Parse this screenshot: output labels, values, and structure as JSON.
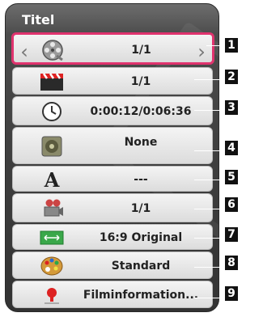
{
  "panel": {
    "title": "Titel"
  },
  "rows": [
    {
      "icon": "film-reel-icon",
      "value": "1/1",
      "callout": "1"
    },
    {
      "icon": "clapperboard-icon",
      "value": "1/1",
      "callout": "2"
    },
    {
      "icon": "clock-icon",
      "value": "0:00:12/0:06:36",
      "callout": "3"
    },
    {
      "icon": "speaker-icon",
      "value": "None",
      "callout": "4"
    },
    {
      "icon": "subtitle-letter-icon",
      "value": "---",
      "callout": "5"
    },
    {
      "icon": "camera-angle-icon",
      "value": "1/1",
      "callout": "6"
    },
    {
      "icon": "aspect-ratio-icon",
      "value": "16:9 Original",
      "callout": "7"
    },
    {
      "icon": "palette-icon",
      "value": "Standard",
      "callout": "8"
    },
    {
      "icon": "info-icon",
      "value": "Filminformation...",
      "callout": "9"
    }
  ],
  "nav": {
    "left_arrow": "‹",
    "right_arrow": "›"
  },
  "colors": {
    "active_border": "#e0336e",
    "row_bg": "#ececec",
    "panel_bg": "#3d3d3d",
    "callout_bg": "#111111"
  }
}
